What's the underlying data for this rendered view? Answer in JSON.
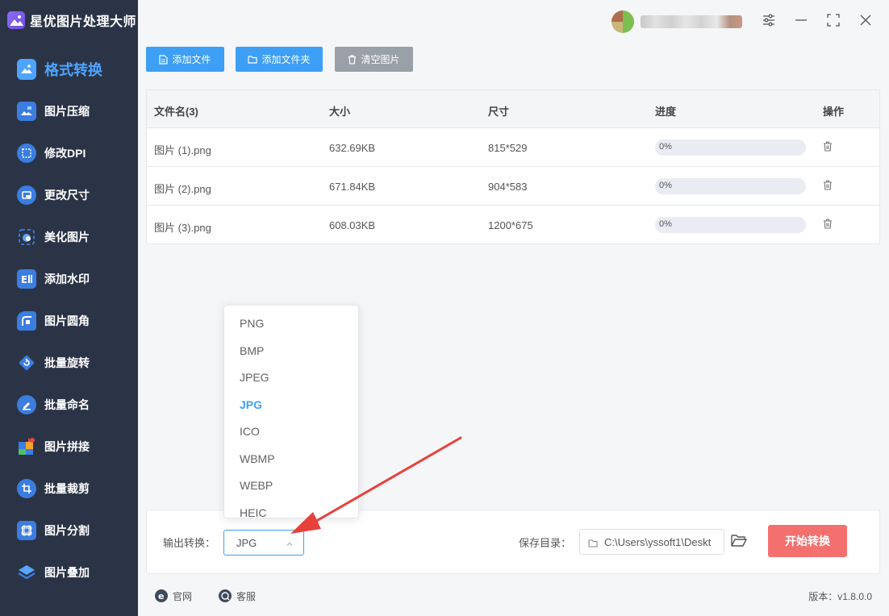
{
  "app": {
    "title": "星优图片处理大师"
  },
  "sidebar": {
    "items": [
      {
        "label": "格式转换",
        "icon": "image-convert-icon",
        "active": true
      },
      {
        "label": "图片压缩",
        "icon": "image-compress-icon"
      },
      {
        "label": "修改DPI",
        "icon": "dpi-icon"
      },
      {
        "label": "更改尺寸",
        "icon": "resize-icon"
      },
      {
        "label": "美化图片",
        "icon": "beautify-icon"
      },
      {
        "label": "添加水印",
        "icon": "watermark-icon"
      },
      {
        "label": "图片圆角",
        "icon": "rounded-corner-icon"
      },
      {
        "label": "批量旋转",
        "icon": "rotate-icon"
      },
      {
        "label": "批量命名",
        "icon": "rename-icon"
      },
      {
        "label": "图片拼接",
        "icon": "puzzle-icon"
      },
      {
        "label": "批量裁剪",
        "icon": "crop-icon"
      },
      {
        "label": "图片分割",
        "icon": "split-icon"
      },
      {
        "label": "图片叠加",
        "icon": "layers-icon"
      }
    ]
  },
  "toolbar": {
    "add_file": "添加文件",
    "add_folder": "添加文件夹",
    "clear": "清空图片"
  },
  "table": {
    "headers": {
      "name": "文件名(3)",
      "size": "大小",
      "dimensions": "尺寸",
      "progress": "进度",
      "action": "操作"
    },
    "rows": [
      {
        "name": "图片 (1).png",
        "size": "632.69KB",
        "dimensions": "815*529",
        "progress": "0%",
        "progress_value": 0
      },
      {
        "name": "图片 (2).png",
        "size": "671.84KB",
        "dimensions": "904*583",
        "progress": "0%",
        "progress_value": 0
      },
      {
        "name": "图片 (3).png",
        "size": "608.03KB",
        "dimensions": "1200*675",
        "progress": "0%",
        "progress_value": 0
      }
    ]
  },
  "output": {
    "label": "输出转换：",
    "selected": "JPG",
    "options": [
      "PNG",
      "BMP",
      "JPEG",
      "JPG",
      "ICO",
      "WBMP",
      "WEBP",
      "HEIC"
    ]
  },
  "save": {
    "label": "保存目录：",
    "path": "C:\\Users\\yssoft1\\Deskt"
  },
  "start_button": "开始转换",
  "footer": {
    "website": "官网",
    "support": "客服",
    "version": "版本：v1.8.0.0"
  },
  "colors": {
    "sidebar_bg": "#2b3446",
    "accent_blue": "#3d9ff5",
    "start_red": "#f4706f",
    "arrow_red": "#e8413c"
  }
}
